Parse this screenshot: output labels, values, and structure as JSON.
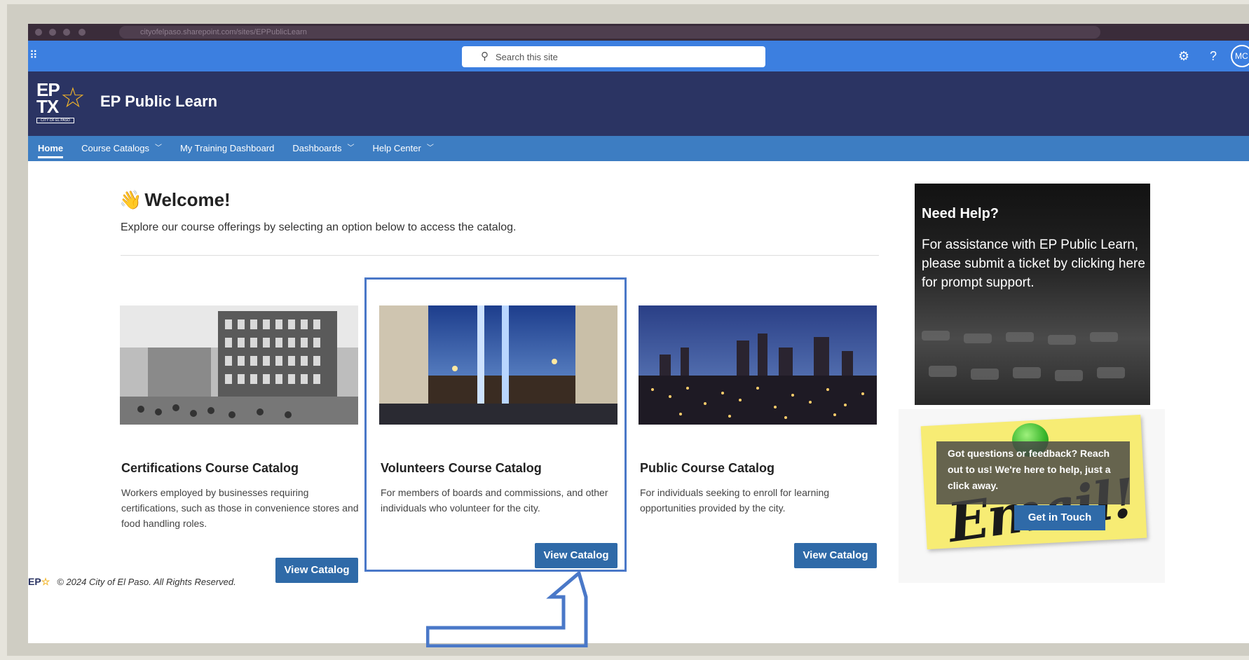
{
  "browser": {
    "url": "cityofelpaso.sharepoint.com/sites/EPPublicLearn"
  },
  "topbar": {
    "search_placeholder": "Search this site",
    "avatar_initials": "MC"
  },
  "header": {
    "logo_line1": "EP",
    "logo_line2": "TX",
    "logo_tag": "CITY OF EL PASO",
    "site_title": "EP Public Learn"
  },
  "nav": {
    "items": [
      {
        "label": "Home",
        "active": true,
        "dropdown": false
      },
      {
        "label": "Course Catalogs",
        "dropdown": true
      },
      {
        "label": "My Training Dashboard",
        "dropdown": false
      },
      {
        "label": "Dashboards",
        "dropdown": true
      },
      {
        "label": "Help Center",
        "dropdown": true
      }
    ]
  },
  "welcome": {
    "title": "Welcome!",
    "subtitle": "Explore our course offerings by selecting an option below to access the catalog."
  },
  "cards": [
    {
      "title": "Certifications Course Catalog",
      "description": "Workers employed by businesses requiring certifications, such as those in convenience stores and food handling roles.",
      "button": "View Catalog"
    },
    {
      "title": "Volunteers Course Catalog",
      "description": "For members of boards and commissions, and other individuals who volunteer for the city.",
      "button": "View Catalog"
    },
    {
      "title": "Public Course Catalog",
      "description": "For individuals seeking to enroll for learning opportunities provided by the city.",
      "button": "View Catalog"
    }
  ],
  "help": {
    "title": "Need Help?",
    "body": "For assistance with EP Public Learn, please submit a ticket by clicking here for prompt support."
  },
  "email": {
    "sticky_text": "Email!",
    "overlay_text": "Got questions or feedback? Reach out to us! We're here to help, just a click away.",
    "button": "Get in Touch"
  },
  "footer": {
    "logo": "EP",
    "copyright": "© 2024 City of El Paso. All Rights Reserved."
  },
  "colors": {
    "topbar": "#3c7fe0",
    "header": "#2b3463",
    "nav": "#3d7dc2",
    "button": "#2f6aa8",
    "highlight": "#4a78c8",
    "star": "#f2b529"
  }
}
